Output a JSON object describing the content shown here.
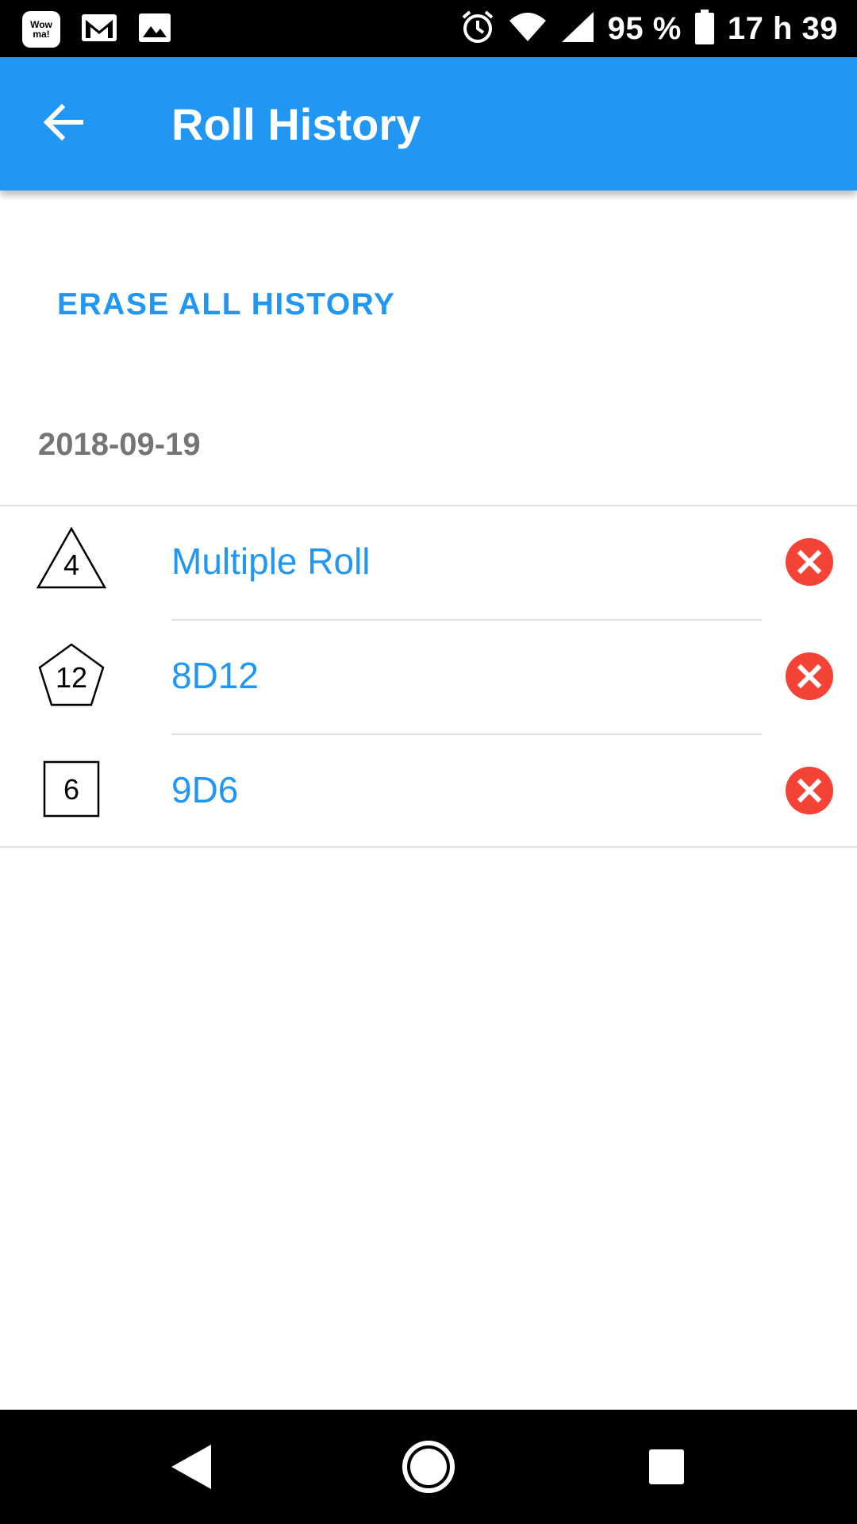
{
  "status_bar": {
    "app_icon_label_line1": "Wow",
    "app_icon_label_line2": "ma!",
    "icons": [
      "wowma-app-icon",
      "gmail-icon",
      "gallery-icon",
      "alarm-icon",
      "wifi-icon",
      "signal-icon",
      "battery-icon"
    ],
    "battery_text": "95 %",
    "time": "17 h 39"
  },
  "app_bar": {
    "title": "Roll History",
    "background_color": "#2196f3"
  },
  "actions": {
    "erase_all_label": "ERASE ALL HISTORY"
  },
  "history": {
    "date": "2018-09-19",
    "items": [
      {
        "die": "4",
        "die_shape": "triangle-d4-icon",
        "label": "Multiple Roll"
      },
      {
        "die": "12",
        "die_shape": "pentagon-d12-icon",
        "label": "8D12"
      },
      {
        "die": "6",
        "die_shape": "square-d6-icon",
        "label": "9D6"
      }
    ]
  },
  "colors": {
    "accent": "#2196f3",
    "delete": "#f44336",
    "date_text": "#757575"
  },
  "nav_bar": {
    "icons": [
      "back-nav-icon",
      "home-nav-icon",
      "recents-nav-icon"
    ]
  }
}
